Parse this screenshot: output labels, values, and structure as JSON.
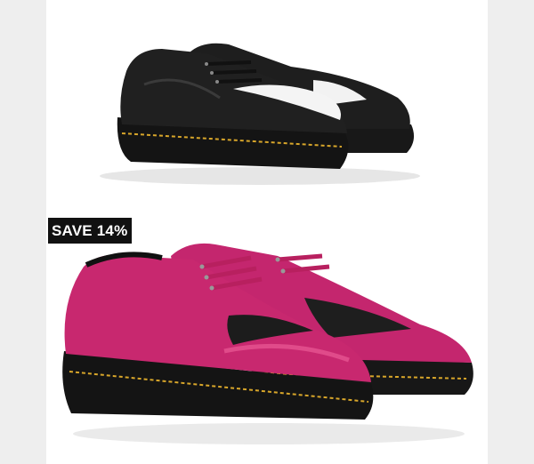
{
  "products": [
    {
      "name": "black-shoe",
      "badge": ""
    },
    {
      "name": "pink-shoe",
      "badge": "SAVE 14%"
    }
  ],
  "colors": {
    "background": "#eeeeee",
    "panel": "#ffffff",
    "badge_bg": "#111111",
    "badge_text": "#ffffff",
    "shoe_black": "#1b1b1b",
    "shoe_white": "#f3f3f3",
    "shoe_pink": "#c4266e",
    "welt_stitch": "#d8a62a"
  }
}
